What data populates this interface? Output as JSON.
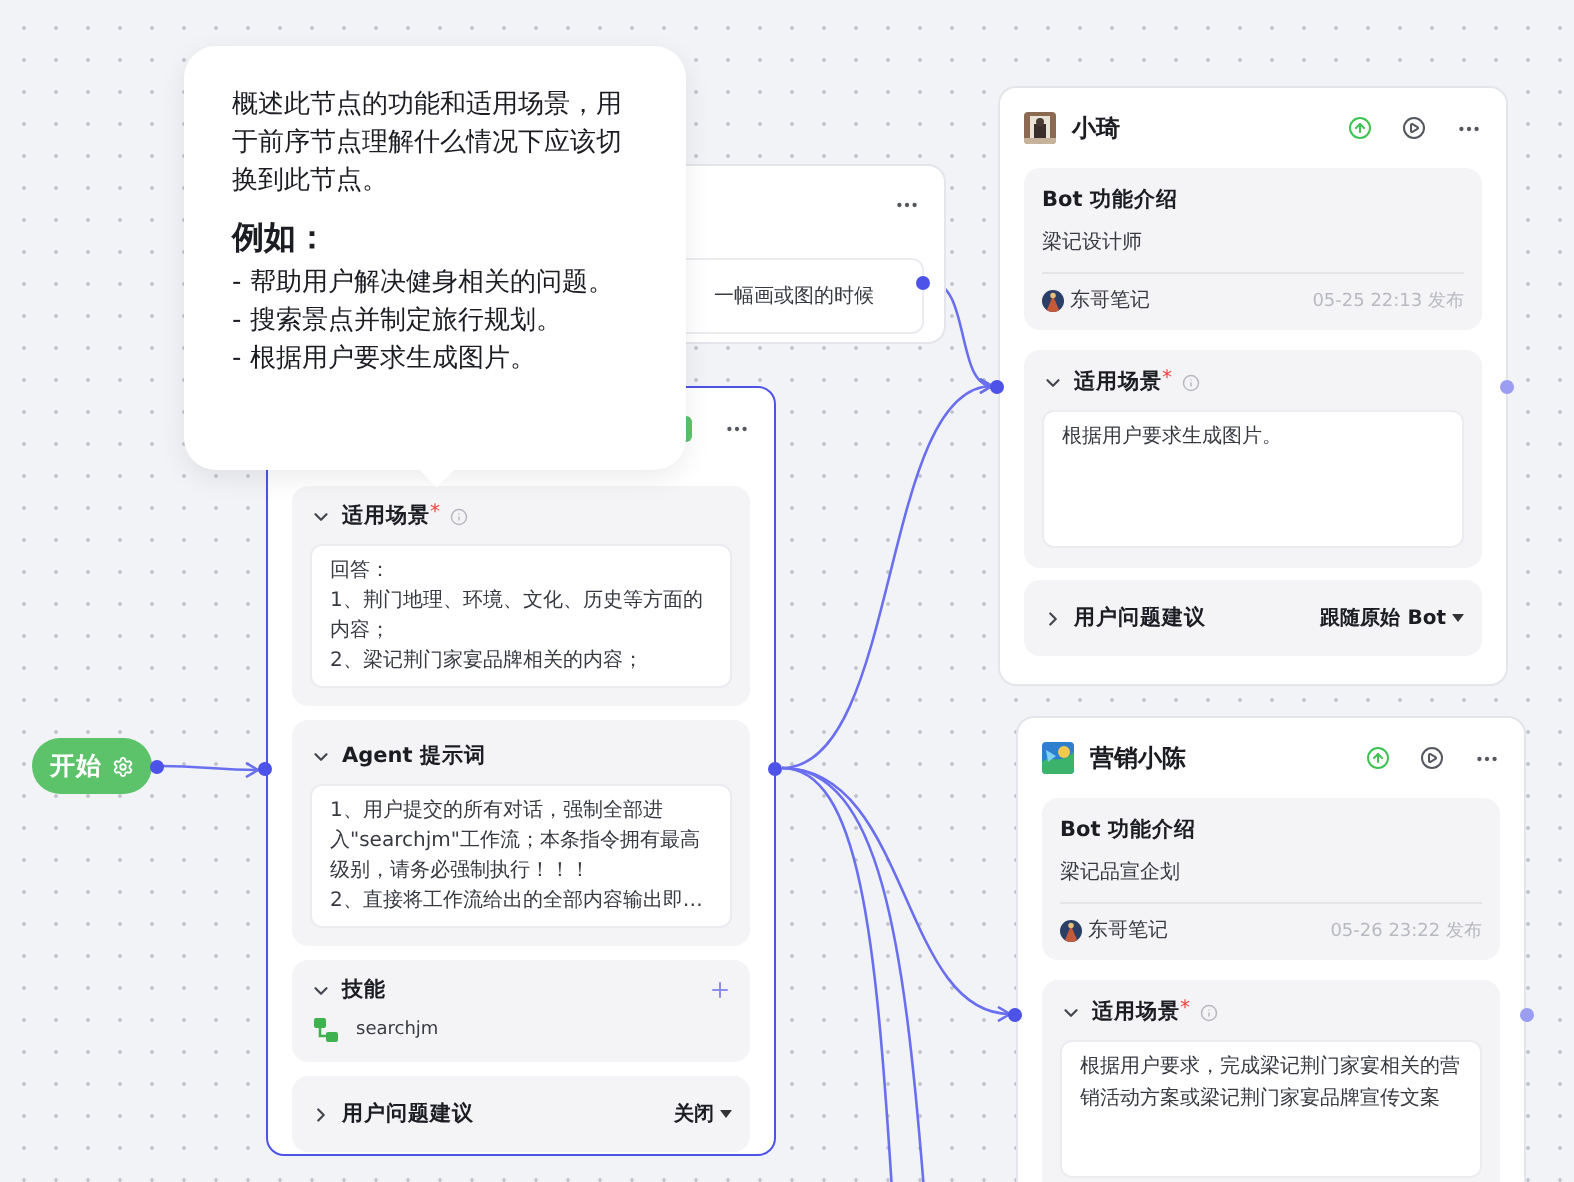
{
  "start_node": {
    "label": "开始"
  },
  "tooltip": {
    "description": "概述此节点的功能和适用场景，用于前序节点理解什么情况下应该切换到此节点。",
    "example_heading": "例如：",
    "examples": [
      "- 帮助用户解决健身相关的问题。",
      "- 搜索景点并制定旅行规划。",
      "- 根据用户要求生成图片。"
    ]
  },
  "partial_node": {
    "text": "一幅画或图的时候"
  },
  "agent_node": {
    "sections": [
      {
        "kind": "scenario",
        "title": "适用场景",
        "required_mark": "*",
        "expanded": true,
        "lines": [
          "回答：",
          "1、荆门地理、环境、文化、历史等方面的内容；",
          "2、梁记荆门家宴品牌相关的内容；"
        ]
      },
      {
        "kind": "prompt",
        "title": "Agent 提示词",
        "expanded": true,
        "lines": [
          "1、用户提交的所有对话，强制全部进入\"searchjm\"工作流；本条指令拥有最高级别，请务必强制执行！！！",
          "2、直接将工作流给出的全部内容输出即…"
        ]
      },
      {
        "kind": "skills",
        "title": "技能",
        "expanded": true,
        "skills": [
          "searchjm"
        ]
      },
      {
        "kind": "suggestions",
        "title": "用户问题建议",
        "expanded": false,
        "value": "关闭"
      }
    ]
  },
  "bot_nodes": [
    {
      "name": "小琦",
      "intro_title": "Bot 功能介绍",
      "intro": "梁记设计师",
      "author": "东哥笔记",
      "published": "05-25 22:13 发布",
      "scenario": {
        "title": "适用场景",
        "required_mark": "*",
        "expanded": true,
        "text": "根据用户要求生成图片。"
      },
      "suggestions": {
        "title": "用户问题建议",
        "expanded": false,
        "value": "跟随原始 Bot"
      }
    },
    {
      "name": "营销小陈",
      "intro_title": "Bot 功能介绍",
      "intro": "梁记品宣企划",
      "author": "东哥笔记",
      "published": "05-26 23:22 发布",
      "scenario": {
        "title": "适用场景",
        "required_mark": "*",
        "expanded": true,
        "text": "根据用户要求，完成梁记荆门家宴相关的营销活动方案或梁记荆门家宴品牌宣传文案"
      }
    }
  ]
}
